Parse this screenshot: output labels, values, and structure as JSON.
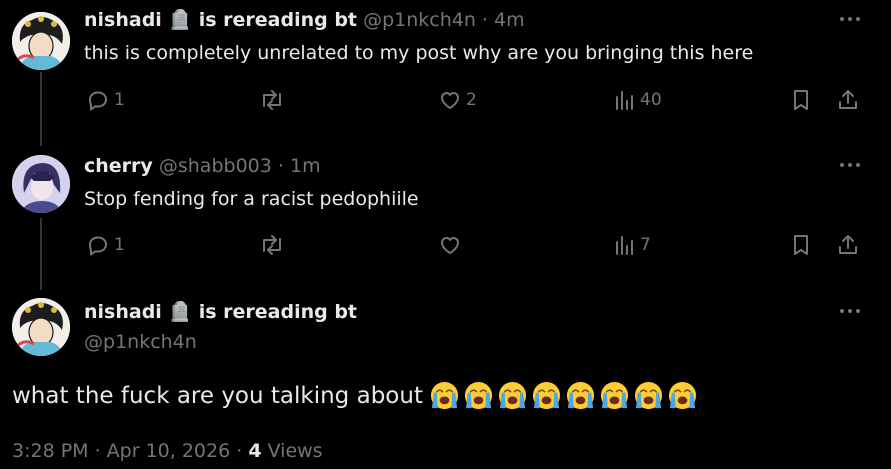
{
  "posts": [
    {
      "display_name": "nishadi 🪦 is rereading bt",
      "handle": "@p1nkch4n",
      "sep": "·",
      "time": "4m",
      "text": "this is completely unrelated to my post why are you bringing this here",
      "replies": "1",
      "reposts": "",
      "likes": "2",
      "views": "40"
    },
    {
      "display_name": "cherry",
      "handle": "@shabb003",
      "sep": "·",
      "time": "1m",
      "text": "Stop fending for a racist pedophiile",
      "replies": "1",
      "reposts": "",
      "likes": "",
      "views": "7"
    }
  ],
  "main_post": {
    "display_name": "nishadi 🪦 is rereading bt",
    "handle": "@p1nkch4n",
    "text": "what the fuck are you talking about",
    "emoji_count": 8,
    "emoji": "loudly-crying-face",
    "timestamp": "3:28 PM · Apr 10, 2026 · ",
    "views_count": "4",
    "views_label": " Views"
  },
  "icons": [
    "more-icon",
    "reply-icon",
    "repost-icon",
    "like-icon",
    "views-icon",
    "bookmark-icon",
    "share-icon"
  ],
  "colors": {
    "background": "#000000",
    "text": "#e7e9ea",
    "muted": "#71767b",
    "line": "#333639"
  }
}
